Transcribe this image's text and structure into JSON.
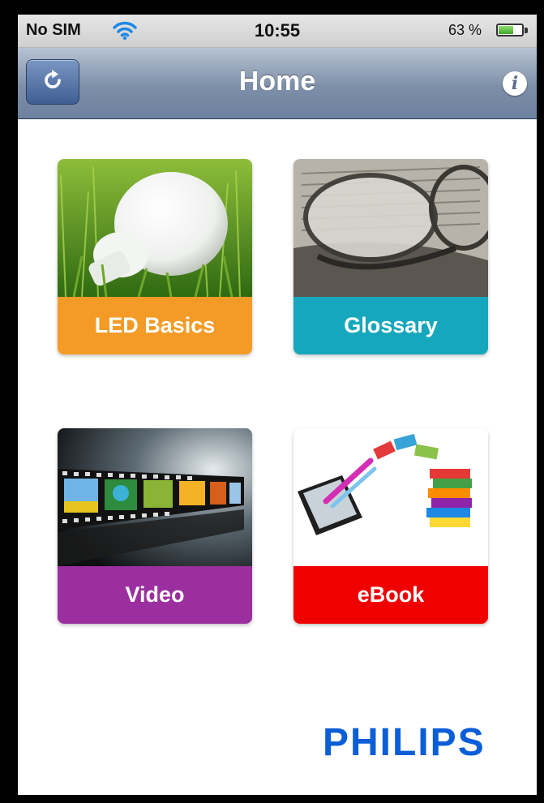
{
  "status_bar": {
    "carrier": "No SIM",
    "time": "10:55",
    "battery_percent": "63 %",
    "battery_level": 0.63
  },
  "nav_bar": {
    "title": "Home",
    "left_button_icon": "refresh-icon",
    "right_button_icon": "info-icon",
    "info_glyph": "i"
  },
  "tiles": [
    {
      "label": "LED Basics",
      "color": "#f39b26",
      "icon": "lightbulb-in-grass-image"
    },
    {
      "label": "Glossary",
      "color": "#17a7bd",
      "icon": "glasses-on-book-image"
    },
    {
      "label": "Video",
      "color": "#9b2f9f",
      "icon": "film-strip-image"
    },
    {
      "label": "eBook",
      "color": "#f00000",
      "icon": "tablet-and-books-image"
    }
  ],
  "footer": {
    "brand": "PHILIPS",
    "brand_color": "#0b5ed7"
  }
}
